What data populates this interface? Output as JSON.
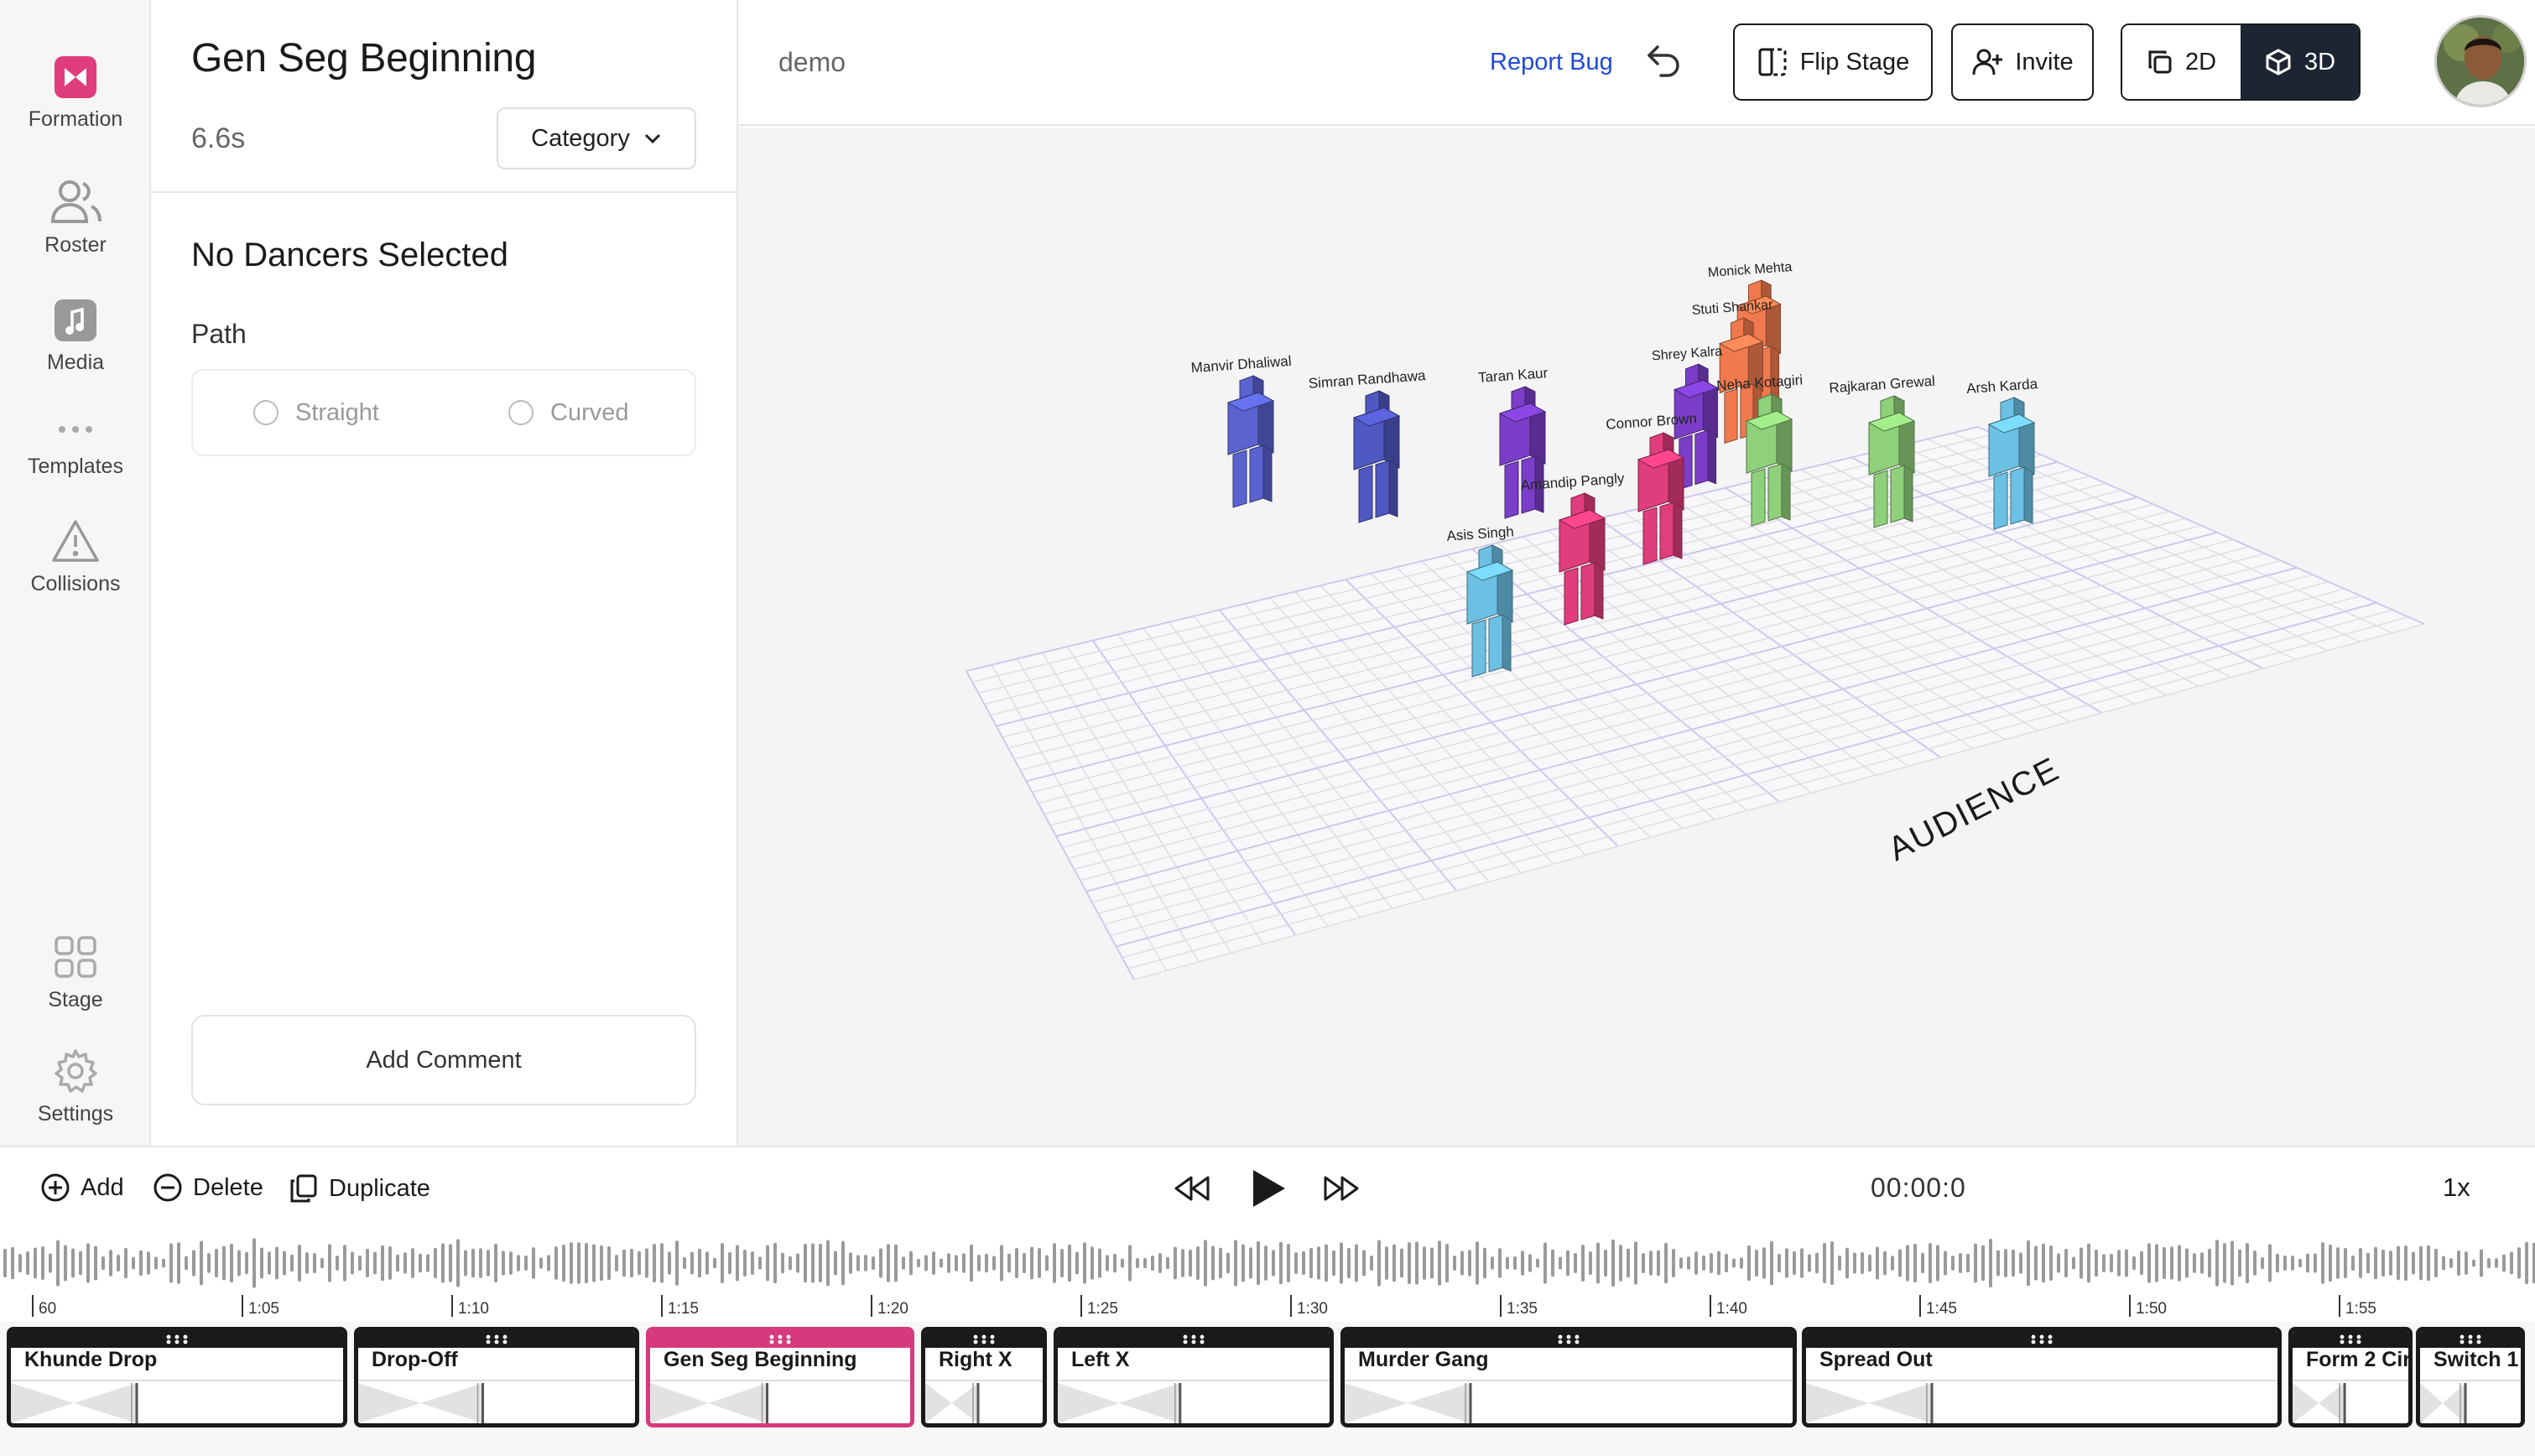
{
  "nav": {
    "formation": "Formation",
    "roster": "Roster",
    "media": "Media",
    "templates": "Templates",
    "collisions": "Collisions",
    "stage": "Stage",
    "settings": "Settings"
  },
  "panel": {
    "formation_title": "Gen Seg Beginning",
    "duration": "6.6s",
    "category_label": "Category",
    "selection_title": "No Dancers Selected",
    "path_label": "Path",
    "path_options": [
      "Straight",
      "Curved"
    ],
    "add_comment": "Add Comment"
  },
  "topbar": {
    "project_name": "demo",
    "report_bug": "Report Bug",
    "flip_stage": "Flip Stage",
    "invite": "Invite",
    "view_2d": "2D",
    "view_3d": "3D",
    "active_view": "3D"
  },
  "stage": {
    "audience_label": "AUDIENCE",
    "dancers": [
      {
        "name": "Manvir Dhaliwal",
        "color": "#5a63cf"
      },
      {
        "name": "Simran Randhawa",
        "color": "#5058c2"
      },
      {
        "name": "Taran Kaur",
        "color": "#7b3ec8"
      },
      {
        "name": "Connor Brown",
        "color": "#e03d7c"
      },
      {
        "name": "Amandip Pangly",
        "color": "#e03d7c"
      },
      {
        "name": "Asis Singh",
        "color": "#6cc0e3"
      },
      {
        "name": "Shrey Kalra",
        "color": "#7b3ec8"
      },
      {
        "name": "Monick Mehta",
        "color": "#f07a4e"
      },
      {
        "name": "Stuti Shankar",
        "color": "#f07a4e"
      },
      {
        "name": "Neha Kotagiri",
        "color": "#8fd07a"
      },
      {
        "name": "Rajkaran Grewal",
        "color": "#8fd07a"
      },
      {
        "name": "Arsh Karda",
        "color": "#6cc0e3"
      }
    ]
  },
  "controls": {
    "add": "Add",
    "delete": "Delete",
    "duplicate": "Duplicate",
    "time": "00:00:0",
    "speed": "1x"
  },
  "ruler": [
    "60",
    "1:05",
    "1:10",
    "1:15",
    "1:20",
    "1:25",
    "1:30",
    "1:35",
    "1:40",
    "1:45",
    "1:50",
    "1:55"
  ],
  "timeline": {
    "formations": [
      {
        "name": "Khunde Drop"
      },
      {
        "name": "Drop-Off"
      },
      {
        "name": "Gen Seg Beginning",
        "selected": true
      },
      {
        "name": "Right X"
      },
      {
        "name": "Left X"
      },
      {
        "name": "Murder Gang"
      },
      {
        "name": "Spread Out"
      },
      {
        "name": "Form 2 Cir"
      },
      {
        "name": "Switch 1"
      }
    ]
  },
  "colors": {
    "accent_pink": "#d63a7c",
    "link_blue": "#1f4ad6",
    "dark": "#1a1a1a"
  }
}
